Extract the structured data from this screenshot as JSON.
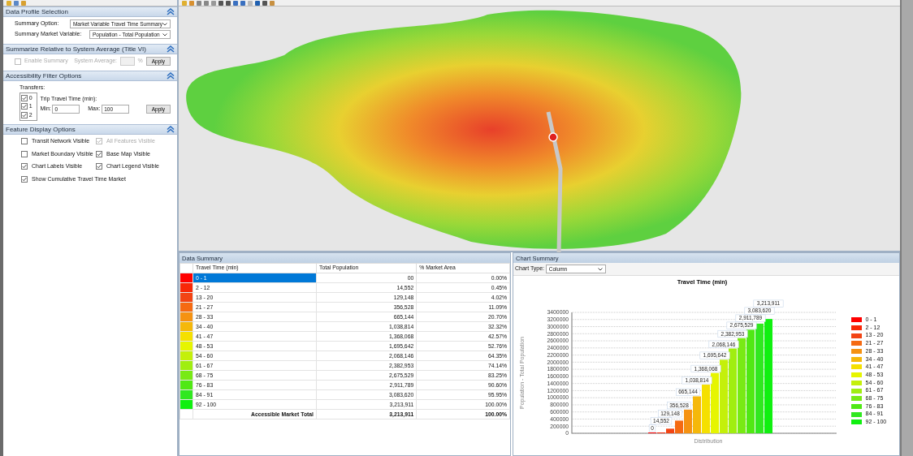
{
  "data_profile": {
    "title": "Data Profile Selection",
    "fields": [
      {
        "label": "Summary Option:",
        "value": "Market Variable Travel Time Summary"
      },
      {
        "label": "Summary Market Variable:",
        "value": "Population - Total Population"
      }
    ]
  },
  "summarize": {
    "title": "Summarize Relative to System Average (Title VI)",
    "enable": {
      "label": "Enable Summary",
      "checked": false,
      "disabled": true
    },
    "average_label": "System Average:",
    "unit": "%",
    "apply": "Apply"
  },
  "accessibility": {
    "title": "Accessibility Filter Options",
    "transfers_label": "Transfers:",
    "transfers": [
      {
        "label": "0",
        "checked": true
      },
      {
        "label": "1",
        "checked": true
      },
      {
        "label": "2",
        "checked": true
      }
    ],
    "time_label": "Trip Travel Time (min):",
    "min_label": "Min:",
    "min": "0",
    "max_label": "Max:",
    "max": "100",
    "apply": "Apply"
  },
  "feature_display": {
    "title": "Feature Display Options",
    "options": [
      {
        "label": "Transit Network Visible",
        "checked": false,
        "disabled": false
      },
      {
        "label": "All Features Visible",
        "checked": true,
        "disabled": true
      },
      {
        "label": "Market Boundary Visible",
        "checked": false,
        "disabled": false
      },
      {
        "label": "Base Map Visible",
        "checked": true,
        "disabled": false
      },
      {
        "label": "Chart Labels Visible",
        "checked": true,
        "disabled": false
      },
      {
        "label": "Chart Legend Visible",
        "checked": true,
        "disabled": false
      },
      {
        "label": "Show Cumulative Travel Time Market",
        "checked": true,
        "disabled": false
      }
    ]
  },
  "data_summary": {
    "title": "Data Summary",
    "columns": [
      "Travel Time (min)",
      "Total Population",
      "% Market Area"
    ],
    "rows": [
      {
        "range": "0 - 1",
        "population": "00",
        "share": "0.00%",
        "color": "#ff0000",
        "selected": true
      },
      {
        "range": "2 - 12",
        "population": "14,552",
        "share": "0.45%",
        "color": "#f82808",
        "selected": false
      },
      {
        "range": "13 - 20",
        "population": "129,148",
        "share": "4.02%",
        "color": "#f24414",
        "selected": false
      },
      {
        "range": "21 - 27",
        "population": "356,528",
        "share": "11.09%",
        "color": "#f56a12",
        "selected": false
      },
      {
        "range": "28 - 33",
        "population": "665,144",
        "share": "20.70%",
        "color": "#f59212",
        "selected": false
      },
      {
        "range": "34 - 40",
        "population": "1,038,814",
        "share": "32.32%",
        "color": "#f5b80a",
        "selected": false
      },
      {
        "range": "41 - 47",
        "population": "1,368,068",
        "share": "42.57%",
        "color": "#f5e000",
        "selected": false
      },
      {
        "range": "48 - 53",
        "population": "1,695,642",
        "share": "52.76%",
        "color": "#e6f500",
        "selected": false
      },
      {
        "range": "54 - 60",
        "population": "2,068,146",
        "share": "64.35%",
        "color": "#c4f00a",
        "selected": false
      },
      {
        "range": "61 - 67",
        "population": "2,382,953",
        "share": "74.14%",
        "color": "#a0ee10",
        "selected": false
      },
      {
        "range": "68 - 75",
        "population": "2,675,529",
        "share": "83.25%",
        "color": "#78ea14",
        "selected": false
      },
      {
        "range": "76 - 83",
        "population": "2,911,789",
        "share": "90.60%",
        "color": "#50e814",
        "selected": false
      },
      {
        "range": "84 - 91",
        "population": "3,083,620",
        "share": "95.95%",
        "color": "#30e820",
        "selected": false
      },
      {
        "range": "92 - 100",
        "population": "3,213,911",
        "share": "100.00%",
        "color": "#10f010",
        "selected": false
      }
    ],
    "total": {
      "label": "Accessible Market Total",
      "population": "3,213,911",
      "share": "100.00%"
    }
  },
  "chart_summary": {
    "title": "Chart Summary",
    "type_label": "Chart Type:",
    "type": "Column",
    "chart_data": {
      "type": "bar",
      "title": "Travel Time (min)",
      "ylabel": "Population - Total Population",
      "categories": [
        "Distribution"
      ],
      "grid": true,
      "series": [
        {
          "name": "0 - 1",
          "color": "#ff0000",
          "values": [
            0
          ],
          "value_labels": [
            "0"
          ]
        },
        {
          "name": "2 - 12",
          "color": "#f82808",
          "values": [
            14552
          ],
          "value_labels": [
            "14,552"
          ]
        },
        {
          "name": "13 - 20",
          "color": "#f24414",
          "values": [
            129148
          ],
          "value_labels": [
            "129,148"
          ]
        },
        {
          "name": "21 - 27",
          "color": "#f56a12",
          "values": [
            356528
          ],
          "value_labels": [
            "356,528"
          ]
        },
        {
          "name": "28 - 33",
          "color": "#f59212",
          "values": [
            665144
          ],
          "value_labels": [
            "665,144"
          ]
        },
        {
          "name": "34 - 40",
          "color": "#f5b80a",
          "values": [
            1038814
          ],
          "value_labels": [
            "1,038,814"
          ]
        },
        {
          "name": "41 - 47",
          "color": "#f5e000",
          "values": [
            1368068
          ],
          "value_labels": [
            "1,368,068"
          ]
        },
        {
          "name": "48 - 53",
          "color": "#e6f500",
          "values": [
            1695642
          ],
          "value_labels": [
            "1,695,642"
          ]
        },
        {
          "name": "54 - 60",
          "color": "#c4f00a",
          "values": [
            2068146
          ],
          "value_labels": [
            "2,068,146"
          ]
        },
        {
          "name": "61 - 67",
          "color": "#a0ee10",
          "values": [
            2382953
          ],
          "value_labels": [
            "2,382,953"
          ]
        },
        {
          "name": "68 - 75",
          "color": "#78ea14",
          "values": [
            2675529
          ],
          "value_labels": [
            "2,675,529"
          ]
        },
        {
          "name": "76 - 83",
          "color": "#50e814",
          "values": [
            2911789
          ],
          "value_labels": [
            "2,911,789"
          ]
        },
        {
          "name": "84 - 91",
          "color": "#30e820",
          "values": [
            3083620
          ],
          "value_labels": [
            "3,083,620"
          ]
        },
        {
          "name": "92 - 100",
          "color": "#10f010",
          "values": [
            3213911
          ],
          "value_labels": [
            "3,213,911"
          ]
        }
      ],
      "ylim": [
        0,
        3400000
      ],
      "yticks": [
        0,
        200000,
        400000,
        600000,
        800000,
        1000000,
        1200000,
        1400000,
        1600000,
        1800000,
        2000000,
        2200000,
        2400000,
        2600000,
        2800000,
        3000000,
        3200000,
        3400000
      ]
    }
  }
}
